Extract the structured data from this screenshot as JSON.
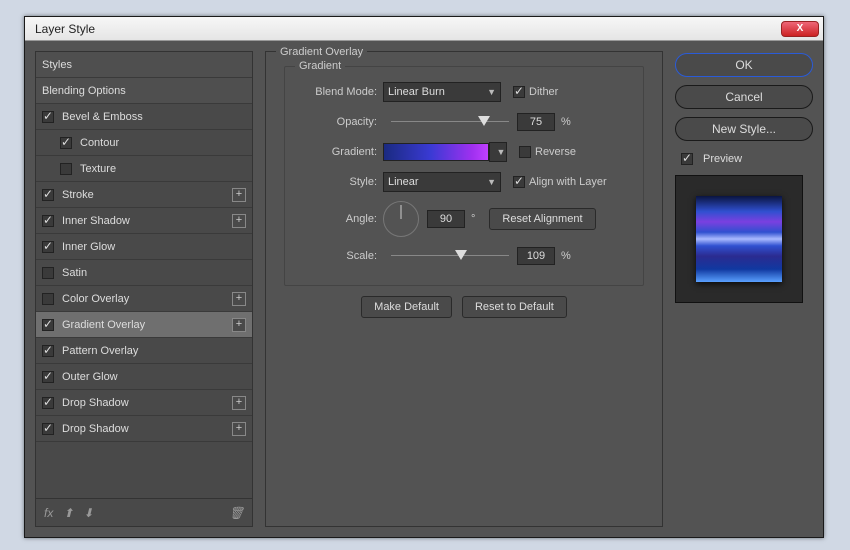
{
  "title": "Layer Style",
  "section_title": "Gradient Overlay",
  "group_title": "Gradient",
  "styles": [
    {
      "label": "Styles",
      "checked": null,
      "plus": false,
      "indent": 0,
      "header": true
    },
    {
      "label": "Blending Options",
      "checked": null,
      "plus": false,
      "indent": 0,
      "header": true
    },
    {
      "label": "Bevel & Emboss",
      "checked": true,
      "plus": false,
      "indent": 0
    },
    {
      "label": "Contour",
      "checked": true,
      "plus": false,
      "indent": 1
    },
    {
      "label": "Texture",
      "checked": false,
      "plus": false,
      "indent": 1
    },
    {
      "label": "Stroke",
      "checked": true,
      "plus": true,
      "indent": 0
    },
    {
      "label": "Inner Shadow",
      "checked": true,
      "plus": true,
      "indent": 0
    },
    {
      "label": "Inner Glow",
      "checked": true,
      "plus": false,
      "indent": 0
    },
    {
      "label": "Satin",
      "checked": false,
      "plus": false,
      "indent": 0
    },
    {
      "label": "Color Overlay",
      "checked": false,
      "plus": true,
      "indent": 0
    },
    {
      "label": "Gradient Overlay",
      "checked": true,
      "plus": true,
      "indent": 0,
      "selected": true
    },
    {
      "label": "Pattern Overlay",
      "checked": true,
      "plus": false,
      "indent": 0
    },
    {
      "label": "Outer Glow",
      "checked": true,
      "plus": false,
      "indent": 0
    },
    {
      "label": "Drop Shadow",
      "checked": true,
      "plus": true,
      "indent": 0
    },
    {
      "label": "Drop Shadow",
      "checked": true,
      "plus": true,
      "indent": 0
    }
  ],
  "form": {
    "blend_mode_label": "Blend Mode:",
    "blend_mode_value": "Linear Burn",
    "dither_label": "Dither",
    "dither": true,
    "opacity_label": "Opacity:",
    "opacity": 75,
    "gradient_label": "Gradient:",
    "reverse_label": "Reverse",
    "reverse": false,
    "style_label": "Style:",
    "style_value": "Linear",
    "align_label": "Align with Layer",
    "align": true,
    "angle_label": "Angle:",
    "angle": 90,
    "reset_align": "Reset Alignment",
    "scale_label": "Scale:",
    "scale": 109,
    "percent": "%",
    "degree": "°",
    "make_default": "Make Default",
    "reset_default": "Reset to Default"
  },
  "buttons": {
    "ok": "OK",
    "cancel": "Cancel",
    "new_style": "New Style..."
  },
  "preview": {
    "label": "Preview",
    "checked": true
  },
  "footer_icons": {
    "fx": "fx",
    "up": "⬆",
    "down": "⬇",
    "trash": "🗑"
  }
}
